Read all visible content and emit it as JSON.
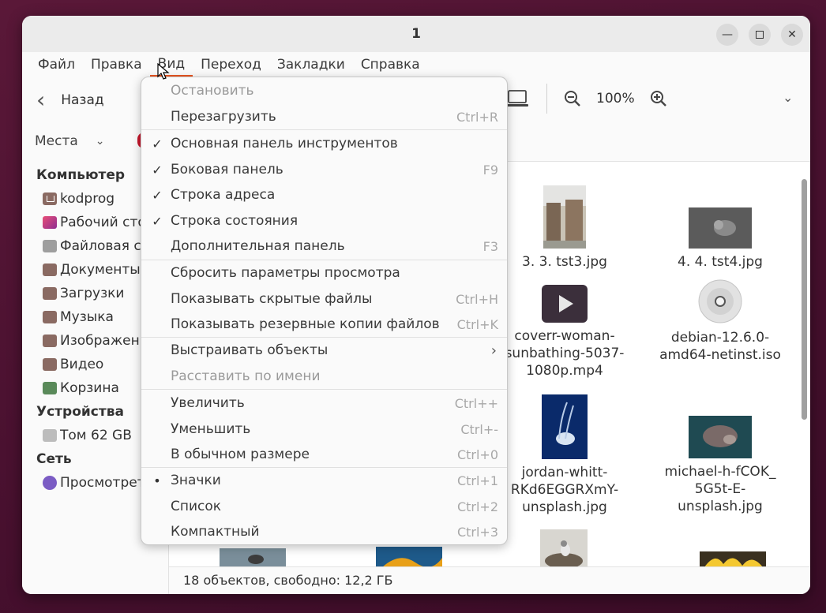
{
  "window": {
    "title": "1"
  },
  "menubar": [
    "Файл",
    "Правка",
    "Вид",
    "Переход",
    "Закладки",
    "Справка"
  ],
  "toolbar": {
    "back_label": "Назад",
    "zoom_value": "100%"
  },
  "places": {
    "label": "Места"
  },
  "sidebar": {
    "computer_heading": "Компьютер",
    "computer_items": [
      "kodprog",
      "Рабочий сто",
      "Файловая с",
      "Документы",
      "Загрузки",
      "Музыка",
      "Изображени",
      "Видео",
      "Корзина"
    ],
    "devices_heading": "Устройства",
    "devices_items": [
      "Том 62 GB"
    ],
    "network_heading": "Сеть",
    "network_items": [
      "Просмотрет"
    ]
  },
  "files": [
    {
      "name": "3. 3. tst3.jpg"
    },
    {
      "name": "4. 4. tst4.jpg"
    },
    {
      "name": "coverr-woman-sunbathing-5037-1080p.mp4"
    },
    {
      "name": "debian-12.6.0-amd64-netinst.iso"
    },
    {
      "name": "jordan-whitt-RKd6EGGRXmY-unsplash.jpg"
    },
    {
      "name": "michael-h-fCOK_5G5t-E-unsplash.jpg"
    }
  ],
  "file_lines": [
    [
      "3. 3. tst3.jpg"
    ],
    [
      "4. 4. tst4.jpg"
    ],
    [
      "coverr-woman-",
      "sunbathing-5037-",
      "1080p.mp4"
    ],
    [
      "debian-12.6.0-",
      "amd64-netinst.iso"
    ],
    [
      "jordan-whitt-",
      "RKd6EGGRXmY-",
      "unsplash.jpg"
    ],
    [
      "michael-h-fCOK_",
      "5G5t-E-unsplash.jpg"
    ]
  ],
  "status": {
    "text": "18 объектов, свободно: 12,2 ГБ"
  },
  "view_menu": {
    "items": [
      {
        "label": "Остановить",
        "shortcut": "",
        "check": "",
        "disabled": true
      },
      {
        "label": "Перезагрузить",
        "shortcut": "Ctrl+R",
        "check": "",
        "disabled": false
      },
      {
        "label": "Основная панель инструментов",
        "shortcut": "",
        "check": "✓",
        "disabled": false
      },
      {
        "label": "Боковая панель",
        "shortcut": "F9",
        "check": "✓",
        "disabled": false
      },
      {
        "label": "Строка адреса",
        "shortcut": "",
        "check": "✓",
        "disabled": false
      },
      {
        "label": "Строка состояния",
        "shortcut": "",
        "check": "✓",
        "disabled": false
      },
      {
        "label": "Дополнительная панель",
        "shortcut": "F3",
        "check": "",
        "disabled": false
      },
      {
        "label": "Сбросить параметры просмотра",
        "shortcut": "",
        "check": "",
        "disabled": false
      },
      {
        "label": "Показывать скрытые файлы",
        "shortcut": "Ctrl+H",
        "check": "",
        "disabled": false
      },
      {
        "label": "Показывать резервные копии файлов",
        "shortcut": "Ctrl+K",
        "check": "",
        "disabled": false
      },
      {
        "label": "Выстраивать объекты",
        "shortcut": "",
        "check": "",
        "disabled": false
      },
      {
        "label": "Расставить по имени",
        "shortcut": "",
        "check": "",
        "disabled": true
      },
      {
        "label": "Увеличить",
        "shortcut": "Ctrl++",
        "check": "",
        "disabled": false
      },
      {
        "label": "Уменьшить",
        "shortcut": "Ctrl+-",
        "check": "",
        "disabled": false
      },
      {
        "label": "В обычном размере",
        "shortcut": "Ctrl+0",
        "check": "",
        "disabled": false
      },
      {
        "label": "Значки",
        "shortcut": "Ctrl+1",
        "check": "•",
        "disabled": false
      },
      {
        "label": "Список",
        "shortcut": "Ctrl+2",
        "check": "",
        "disabled": false
      },
      {
        "label": "Компактный",
        "shortcut": "Ctrl+3",
        "check": "",
        "disabled": false
      }
    ]
  }
}
